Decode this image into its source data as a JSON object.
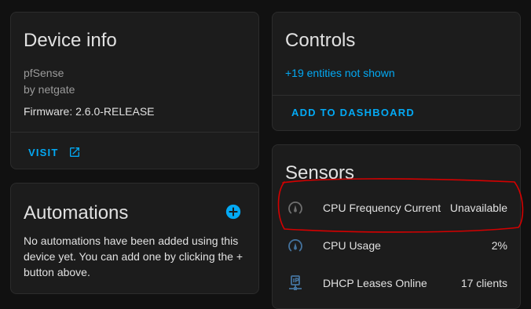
{
  "device_info": {
    "title": "Device info",
    "model": "pfSense",
    "manufacturer": "by netgate",
    "firmware": "Firmware: 2.6.0-RELEASE",
    "visit_label": "VISIT"
  },
  "automations": {
    "title": "Automations",
    "empty_text": "No automations have been added using this device yet. You can add one by clicking the + button above."
  },
  "controls": {
    "title": "Controls",
    "hidden_entities": "+19 entities not shown",
    "add_label": "ADD TO DASHBOARD"
  },
  "sensors": {
    "title": "Sensors",
    "items": [
      {
        "name": "CPU Frequency Current",
        "state": "Unavailable",
        "icon": "gauge-icon"
      },
      {
        "name": "CPU Usage",
        "state": "2%",
        "icon": "gauge-icon"
      },
      {
        "name": "DHCP Leases Online",
        "state": "17 clients",
        "icon": "ip-network-icon"
      }
    ]
  },
  "colors": {
    "accent": "#03a9f4",
    "annotation": "#d40000",
    "icon": "#44739e"
  }
}
